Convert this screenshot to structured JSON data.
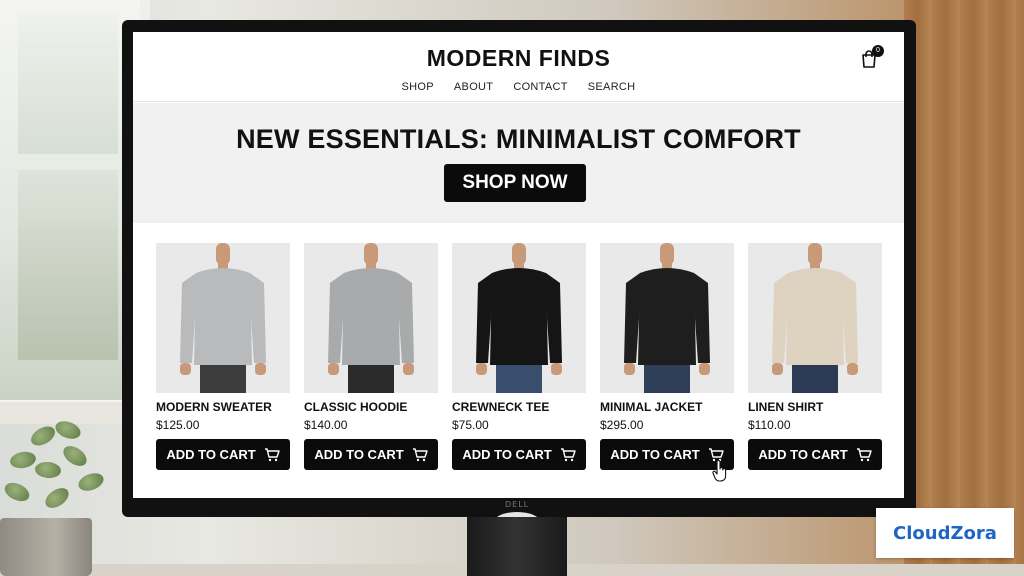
{
  "store": {
    "name": "MODERN FINDS",
    "nav": [
      "SHOP",
      "ABOUT",
      "CONTACT",
      "SEARCH"
    ],
    "cart_count": "0",
    "cart_icon": "shopping-bag-icon"
  },
  "hero": {
    "title": "NEW ESSENTIALS: MINIMALIST COMFORT",
    "button_label": "SHOP NOW"
  },
  "products": [
    {
      "name": "MODERN SWEATER",
      "price": "$125.00",
      "button_label": "ADD TO CART",
      "garment_color": "#b9babb",
      "pants_color": "#3d3d3d"
    },
    {
      "name": "CLASSIC HOODIE",
      "price": "$140.00",
      "button_label": "ADD TO CART",
      "garment_color": "#a9aaab",
      "pants_color": "#2b2b2b"
    },
    {
      "name": "CREWNECK TEE",
      "price": "$75.00",
      "button_label": "ADD TO CART",
      "garment_color": "#151515",
      "pants_color": "#3a4f6e"
    },
    {
      "name": "MINIMAL JACKET",
      "price": "$295.00",
      "button_label": "ADD TO CART",
      "garment_color": "#1e1e1e",
      "pants_color": "#2f3f57"
    },
    {
      "name": "LINEN SHIRT",
      "price": "$110.00",
      "button_label": "ADD TO CART",
      "garment_color": "#ddd3c0",
      "pants_color": "#2c3a55"
    }
  ],
  "monitor_brand": "DELL",
  "watermark": "CloudZora",
  "colors": {
    "button_bg": "#0b0b0b",
    "hero_bg": "#f1f1f1",
    "watermark_text": "#1f66c4"
  }
}
